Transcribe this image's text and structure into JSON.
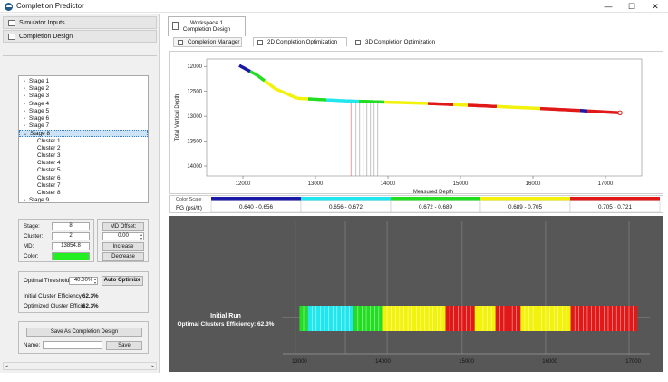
{
  "window": {
    "title": "Completion Predictor",
    "controls": [
      "—",
      "☐",
      "✕"
    ]
  },
  "left_panel": {
    "accordions": [
      "Simulator Inputs",
      "Completion Design"
    ],
    "tree": [
      {
        "label": "Stage 1",
        "level": 0,
        "arrow": "›"
      },
      {
        "label": "Stage 2",
        "level": 0,
        "arrow": "›"
      },
      {
        "label": "Stage 3",
        "level": 0,
        "arrow": "›"
      },
      {
        "label": "Stage 4",
        "level": 0,
        "arrow": "›"
      },
      {
        "label": "Stage 5",
        "level": 0,
        "arrow": "›"
      },
      {
        "label": "Stage 6",
        "level": 0,
        "arrow": "›"
      },
      {
        "label": "Stage 7",
        "level": 0,
        "arrow": "›"
      },
      {
        "label": "Stage 8",
        "level": 0,
        "arrow": "⌄",
        "selected": true
      },
      {
        "label": "Cluster 1",
        "level": 1
      },
      {
        "label": "Cluster 2",
        "level": 1
      },
      {
        "label": "Cluster 3",
        "level": 1
      },
      {
        "label": "Cluster 4",
        "level": 1
      },
      {
        "label": "Cluster 5",
        "level": 1
      },
      {
        "label": "Cluster 6",
        "level": 1
      },
      {
        "label": "Cluster 7",
        "level": 1
      },
      {
        "label": "Cluster 8",
        "level": 1
      },
      {
        "label": "Stage 9",
        "level": 0,
        "arrow": "›"
      }
    ],
    "details": {
      "stage_label": "Stage:",
      "stage_value": "8",
      "cluster_label": "Cluster:",
      "cluster_value": "2",
      "md_label": "MD:",
      "md_value": "13854.8",
      "color_label": "Color:",
      "color_value": "#22ee22",
      "md_offset_button": "MD Offset:",
      "md_offset_value": "0.00",
      "increase_button": "Increase",
      "decrease_button": "Decrease"
    },
    "optimize": {
      "threshold_label": "Optimal Threshold",
      "threshold_value": "40.00%",
      "auto_optimize_button": "Auto Optimize",
      "initial_label": "Initial Cluster Efficiency",
      "initial_value": "62.3%",
      "optimized_label": "Optimized Cluster Efficie",
      "optimized_value": "62.3%"
    },
    "save": {
      "save_as_button": "Save As Completion Design",
      "name_label": "Name:",
      "name_value": "",
      "save_button": "Save"
    }
  },
  "workspace": {
    "tab_line1": "Workspace 1",
    "tab_line2": "Completion Design",
    "subtabs": [
      "Completion Manager",
      "2D Completion Optimization",
      "3D Completion Optimization"
    ],
    "active_subtab": 1
  },
  "colors": {
    "blue": "#1a1aa6",
    "cyan": "#22e6ee",
    "green": "#22dd22",
    "yellow": "#f2f20c",
    "red": "#e01818"
  },
  "chart_data": [
    {
      "type": "line",
      "xlabel": "Measured Depth",
      "ylabel": "Total Vertical Depth",
      "xlim": [
        11500,
        17500
      ],
      "ylim": [
        14200,
        11850
      ],
      "y_inverted": true,
      "xticks": [
        "12000",
        "13000",
        "14000",
        "15000",
        "16000",
        "17000"
      ],
      "yticks": [
        "12000",
        "12500",
        "13000",
        "13500",
        "14000"
      ],
      "path": [
        {
          "x": 11950,
          "y": 11980
        },
        {
          "x": 12200,
          "y": 12180
        },
        {
          "x": 12450,
          "y": 12450
        },
        {
          "x": 12750,
          "y": 12640
        },
        {
          "x": 13400,
          "y": 12690
        },
        {
          "x": 14500,
          "y": 12740
        },
        {
          "x": 15600,
          "y": 12810
        },
        {
          "x": 16600,
          "y": 12880
        },
        {
          "x": 17200,
          "y": 12930
        }
      ],
      "segments": [
        {
          "from": 11950,
          "to": 12100,
          "color": "blue"
        },
        {
          "from": 12100,
          "to": 12300,
          "color": "green"
        },
        {
          "from": 12300,
          "to": 12550,
          "color": "yellow"
        },
        {
          "from": 12550,
          "to": 12750,
          "color": "yellow"
        },
        {
          "from": 12750,
          "to": 12900,
          "color": "yellow"
        },
        {
          "from": 12900,
          "to": 13150,
          "color": "green"
        },
        {
          "from": 13150,
          "to": 13600,
          "color": "cyan"
        },
        {
          "from": 13600,
          "to": 13950,
          "color": "green"
        },
        {
          "from": 13950,
          "to": 14550,
          "color": "yellow"
        },
        {
          "from": 14550,
          "to": 14900,
          "color": "red"
        },
        {
          "from": 14900,
          "to": 15100,
          "color": "yellow"
        },
        {
          "from": 15100,
          "to": 15500,
          "color": "red"
        },
        {
          "from": 15500,
          "to": 16100,
          "color": "yellow"
        },
        {
          "from": 16100,
          "to": 16650,
          "color": "red"
        },
        {
          "from": 16650,
          "to": 16750,
          "color": "blue"
        },
        {
          "from": 16750,
          "to": 17200,
          "color": "red"
        }
      ],
      "marker_lines": [
        13490,
        13560,
        13610,
        13660,
        13710,
        13760,
        13810,
        13860
      ]
    },
    {
      "type": "table",
      "header": "Color Scale",
      "row_label": "FG (psi/ft)",
      "bins": [
        {
          "range": "0.640 - 0.656",
          "color": "blue"
        },
        {
          "range": "0.656 - 0.672",
          "color": "cyan"
        },
        {
          "range": "0.672 - 0.689",
          "color": "green"
        },
        {
          "range": "0.689 - 0.705",
          "color": "yellow"
        },
        {
          "range": "0.705 - 0.721",
          "color": "red"
        }
      ]
    },
    {
      "type": "bar",
      "title_line1": "Initial Run",
      "title_line2": "Optimal Clusters Efficiency: 62.3%",
      "xlim": [
        12800,
        17200
      ],
      "xticks": [
        "13000",
        "14000",
        "15000",
        "16000",
        "17000"
      ],
      "grid_x": [
        12950,
        13550,
        14050,
        14950,
        15950,
        16950
      ],
      "row": [
        {
          "from": 13000,
          "to": 13100,
          "color": "green"
        },
        {
          "from": 13100,
          "to": 13650,
          "color": "cyan"
        },
        {
          "from": 13650,
          "to": 14000,
          "color": "green"
        },
        {
          "from": 14000,
          "to": 14750,
          "color": "yellow"
        },
        {
          "from": 14750,
          "to": 15100,
          "color": "red"
        },
        {
          "from": 15100,
          "to": 15350,
          "color": "yellow"
        },
        {
          "from": 15350,
          "to": 15650,
          "color": "red"
        },
        {
          "from": 15650,
          "to": 16250,
          "color": "yellow"
        },
        {
          "from": 16250,
          "to": 17050,
          "color": "red"
        }
      ],
      "cluster_width": 50
    }
  ]
}
